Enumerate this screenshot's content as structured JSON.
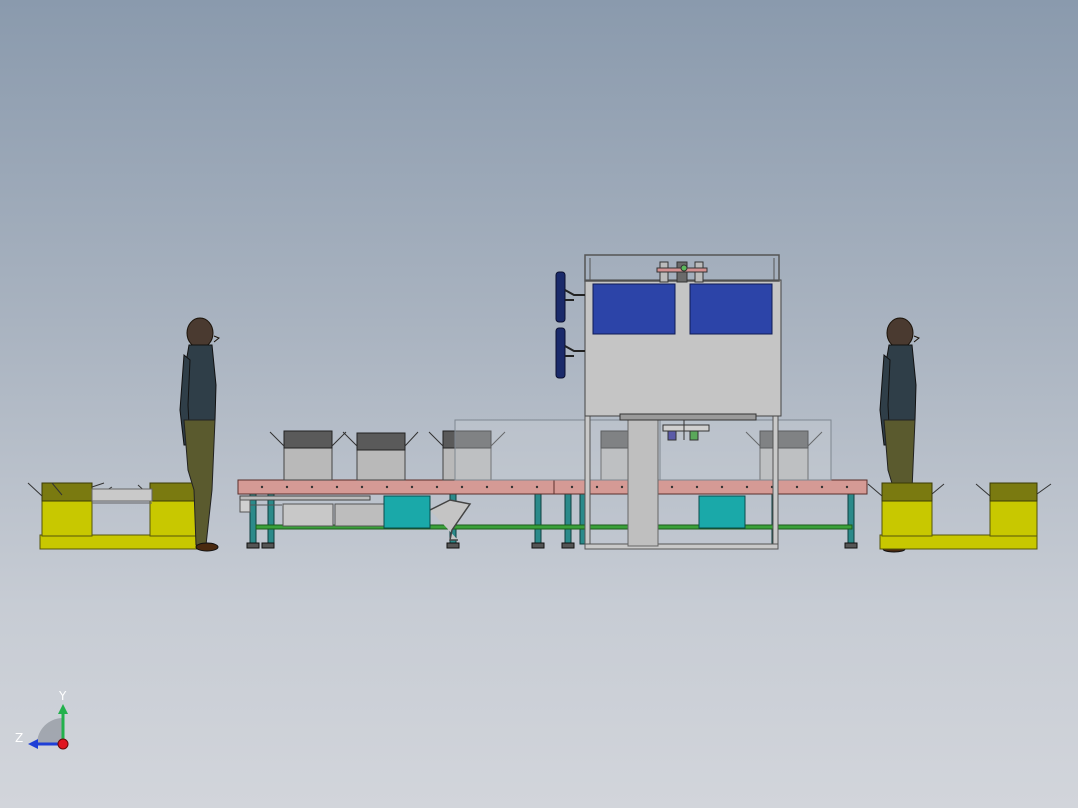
{
  "triad": {
    "y_label": "Y",
    "z_label": "Z",
    "y_color": "#22b14c",
    "z_color": "#1f3fd6",
    "x_color": "#e0141e"
  },
  "colors": {
    "background_top": "#8a9aad",
    "background_bottom": "#d2d5db",
    "hopper_panel": "#2c44a8",
    "roller_table": "#d59a95",
    "frame_leg": "#2b8a8a",
    "cross_rail": "#3aa13a",
    "control_box": "#1aa9a9",
    "pallet_yellow": "#c8c800",
    "carton": "#b9b9b9",
    "carton_top": "#5a5a5a",
    "machine_body": "#c5c5c5"
  }
}
